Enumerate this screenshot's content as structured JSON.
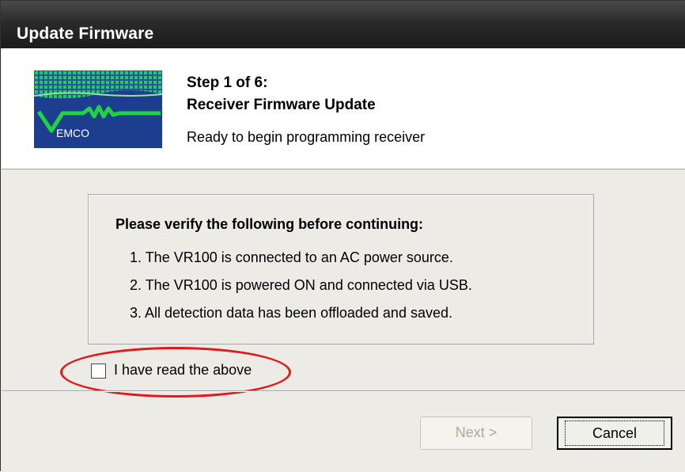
{
  "window": {
    "title": "Update Firmware"
  },
  "header": {
    "step_title": "Step 1 of 6:",
    "step_subtitle": "Receiver Firmware Update",
    "step_description": "Ready to begin programming receiver",
    "logo_text": "EMCO",
    "logo_icon": "vemco-logo"
  },
  "panel": {
    "heading": "Please verify the following before continuing:",
    "items": [
      "1. The VR100 is connected to an AC power source.",
      "2. The VR100 is powered ON and connected via USB.",
      "3. All detection data has been offloaded and saved."
    ]
  },
  "confirm": {
    "label": "I have read the above",
    "checked": false
  },
  "buttons": {
    "next": "Next >",
    "cancel": "Cancel"
  },
  "colors": {
    "highlight_oval": "#e0191b",
    "logo_blue": "#1d3d8f",
    "logo_green": "#19c23a"
  }
}
